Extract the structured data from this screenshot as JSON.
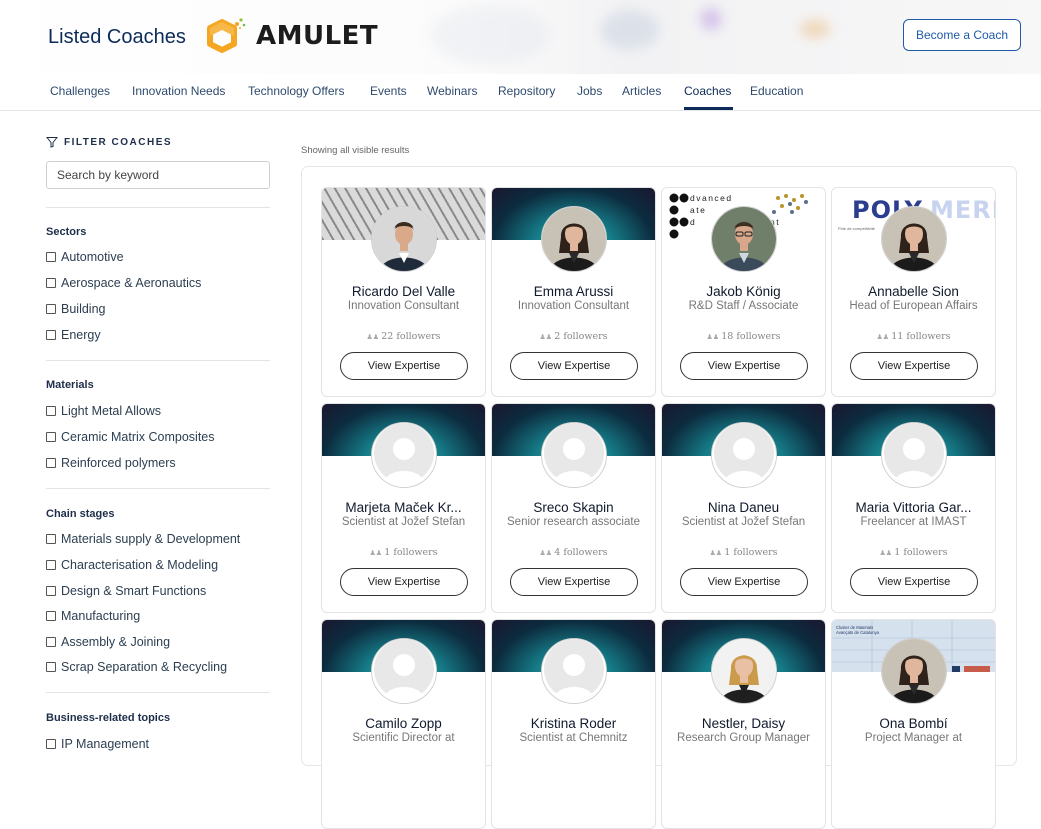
{
  "header": {
    "site_title": "Listed Coaches",
    "logo_text": "AMULET",
    "become_coach": "Become a Coach"
  },
  "nav": {
    "items": [
      "Challenges",
      "Innovation Needs",
      "Technology Offers",
      "Events",
      "Webinars",
      "Repository",
      "Jobs",
      "Articles",
      "Coaches",
      "Education"
    ],
    "active": "Coaches"
  },
  "sidebar": {
    "filter_title": "FILTER COACHES",
    "search_placeholder": "Search by keyword",
    "groups": [
      {
        "title": "Sectors",
        "options": [
          "Automotive",
          "Aerospace & Aeronautics",
          "Building",
          "Energy"
        ]
      },
      {
        "title": "Materials",
        "options": [
          "Light Metal Allows",
          "Ceramic Matrix Composites",
          "Reinforced polymers"
        ]
      },
      {
        "title": "Chain stages",
        "options": [
          "Materials supply & Development",
          "Characterisation & Modeling",
          "Design & Smart Functions",
          "Manufacturing",
          "Assembly & Joining",
          "Scrap Separation & Recycling"
        ]
      },
      {
        "title": "Business-related topics",
        "options": [
          "IP Management"
        ]
      }
    ]
  },
  "main": {
    "showing_text": "Showing all visible results",
    "view_label": "View Expertise",
    "coaches": [
      {
        "name": "Ricardo Del Valle",
        "role": "Innovation Consultant",
        "followers": "22 followers",
        "banner": "hex",
        "photo": "man-suit"
      },
      {
        "name": "Emma Arussi",
        "role": "Innovation Consultant",
        "followers": "2 followers",
        "banner": "teal",
        "photo": "woman-dark-hair"
      },
      {
        "name": "Jakob König",
        "role": "R&D Staff / Associate",
        "followers": "18 followers",
        "banner": "advanced",
        "banner_text": "advanced materials development",
        "photo": "man-glasses"
      },
      {
        "name": "Annabelle Sion",
        "role": "Head of European Affairs",
        "followers": "11 followers",
        "banner": "polymeri",
        "banner_text": "POLYMERI",
        "photo": "woman-dark-hair"
      },
      {
        "name": "Marjeta Maček Kr...",
        "role": "Scientist at Jožef Stefan",
        "followers": "1 followers",
        "banner": "teal",
        "photo": "placeholder"
      },
      {
        "name": "Sreco Skapin",
        "role": "Senior research associate",
        "followers": "4 followers",
        "banner": "teal",
        "photo": "placeholder"
      },
      {
        "name": "Nina Daneu",
        "role": "Scientist at Jožef Stefan",
        "followers": "1 followers",
        "banner": "teal",
        "photo": "placeholder"
      },
      {
        "name": "Maria Vittoria Gar...",
        "role": "Freelancer at IMAST",
        "followers": "1 followers",
        "banner": "teal",
        "photo": "placeholder"
      },
      {
        "name": "Camilo Zopp",
        "role": "Scientific Director at",
        "followers": "",
        "banner": "teal",
        "photo": "placeholder"
      },
      {
        "name": "Kristina Roder",
        "role": "Scientist at Chemnitz",
        "followers": "",
        "banner": "teal",
        "photo": "placeholder"
      },
      {
        "name": "Nestler, Daisy",
        "role": "Research Group Manager",
        "followers": "",
        "banner": "teal",
        "photo": "woman-blonde"
      },
      {
        "name": "Ona Bombí",
        "role": "Project Manager at",
        "followers": "",
        "banner": "cluster",
        "banner_text": "Cluster de Materials Avançats de Catalunya",
        "photo": "woman-dark-hair"
      }
    ]
  },
  "colors": {
    "navy": "#0d2b59",
    "accent_blue": "#1f5ba8",
    "logo_orange": "#f5a623"
  }
}
